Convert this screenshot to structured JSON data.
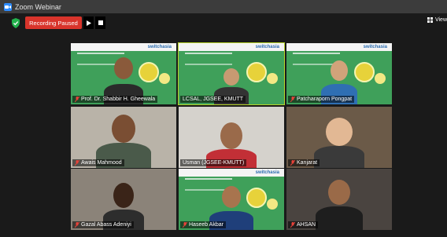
{
  "window": {
    "title": "Zoom Webinar"
  },
  "toolbar": {
    "recording_label": "Recording Paused",
    "view_label": "View"
  },
  "participants": [
    {
      "name": "Prof. Dr. Shabbir H. Gheewala",
      "background": "slide"
    },
    {
      "name": "LCSAL, JGSEE, KMUTT",
      "background": "slide",
      "active": true
    },
    {
      "name": "Patcharaporn Pongpat",
      "background": "slide"
    },
    {
      "name": "Awais Mahmood",
      "background": "room"
    },
    {
      "name": "Usman (JGSEE-KMUTT)",
      "background": "room"
    },
    {
      "name": "Kanjarat",
      "background": "room"
    },
    {
      "name": "Gazal Abass Adeniyi",
      "background": "room"
    },
    {
      "name": "Haseeb Akbar",
      "background": "slide"
    },
    {
      "name": "AHSAN",
      "background": "room"
    }
  ],
  "slide": {
    "brand": "switchasia"
  },
  "colors": {
    "record_red": "#d9342b",
    "active_speaker": "#b8d52a",
    "mic_muted": "#e8433a"
  }
}
